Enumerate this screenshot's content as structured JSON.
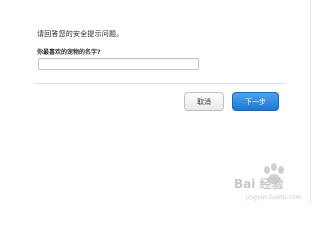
{
  "dialog": {
    "prompt": "请回答您的安全提示问题。",
    "question_label": "你最喜欢的宠物的名字?",
    "answer_value": "",
    "buttons": {
      "cancel": "取消",
      "next": "下一步"
    }
  },
  "watermark": {
    "brand_text": "Bai 经验",
    "url": "jingyan.baidu.com"
  },
  "colors": {
    "primary_button": "#2e8ae0",
    "secondary_button": "#f2f2f2",
    "watermark": "#999999"
  }
}
